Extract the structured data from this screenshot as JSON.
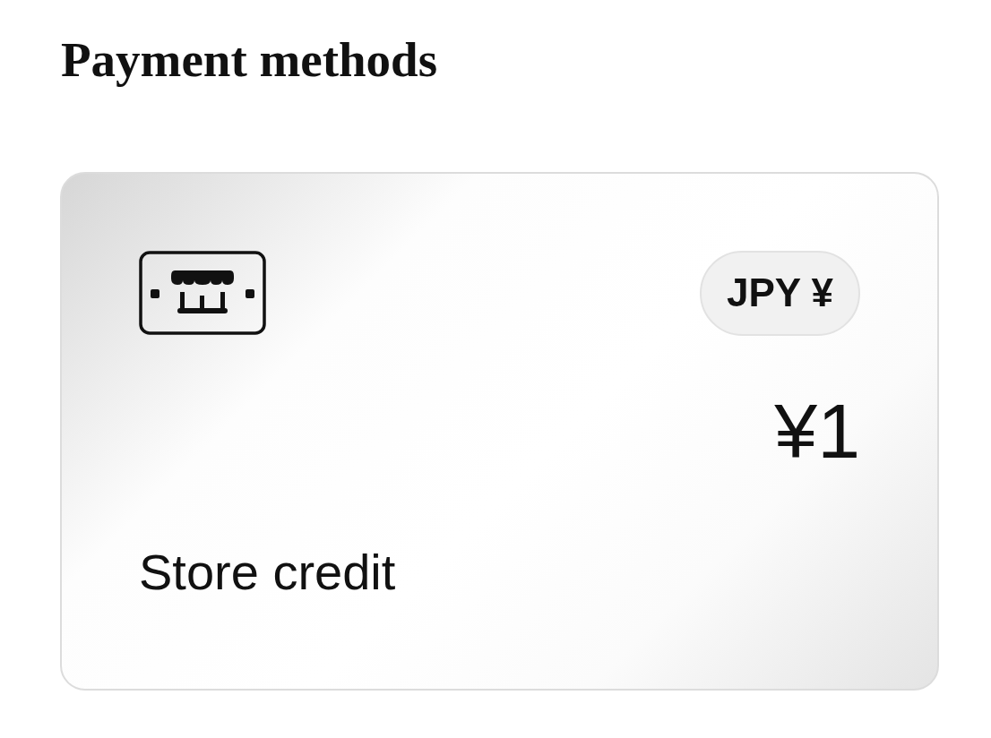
{
  "heading": "Payment methods",
  "payment_methods": [
    {
      "kind": "store_credit",
      "currency_badge": "JPY ¥",
      "amount": "¥1",
      "label": "Store credit"
    }
  ]
}
